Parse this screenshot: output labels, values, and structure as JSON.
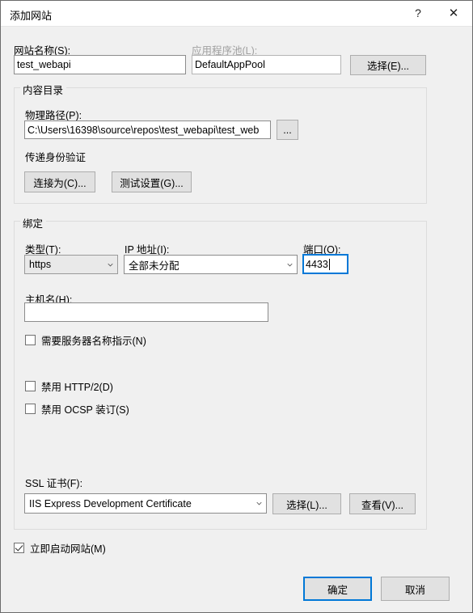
{
  "window": {
    "title": "添加网站",
    "help_label": "?",
    "close_label": "✕"
  },
  "site": {
    "name_label": "网站名称(S):",
    "name_value": "test_webapi",
    "pool_label": "应用程序池(L):",
    "pool_value": "DefaultAppPool",
    "pool_select_button": "选择(E)..."
  },
  "content_directory": {
    "group_title": "内容目录",
    "physical_path_label": "物理路径(P):",
    "physical_path_value": "C:\\Users\\16398\\source\\repos\\test_webapi\\test_web",
    "browse_button": "...",
    "pass_through_label": "传递身份验证",
    "connect_as_button": "连接为(C)...",
    "test_settings_button": "测试设置(G)..."
  },
  "binding": {
    "group_title": "绑定",
    "type_label": "类型(T):",
    "type_value": "https",
    "ip_label": "IP 地址(I):",
    "ip_value": "全部未分配",
    "port_label": "端口(O):",
    "port_value": "4433",
    "host_label": "主机名(H):",
    "host_value": "",
    "require_sni_label": "需要服务器名称指示(N)",
    "require_sni_checked": false,
    "disable_http2_label": "禁用 HTTP/2(D)",
    "disable_http2_checked": false,
    "disable_ocsp_label": "禁用 OCSP 装订(S)",
    "disable_ocsp_checked": false,
    "ssl_cert_label": "SSL 证书(F):",
    "ssl_cert_value": "IIS Express Development Certificate",
    "ssl_select_button": "选择(L)...",
    "ssl_view_button": "查看(V)..."
  },
  "footer": {
    "start_immediately_label": "立即启动网站(M)",
    "start_immediately_checked": true,
    "ok_button": "确定",
    "cancel_button": "取消"
  },
  "colors": {
    "dialog_bg": "#f0f0f0",
    "accent": "#0078d7",
    "field_border": "#8c8c8c",
    "button_face": "#e1e1e1",
    "disabled_text": "#a0a0a0"
  }
}
